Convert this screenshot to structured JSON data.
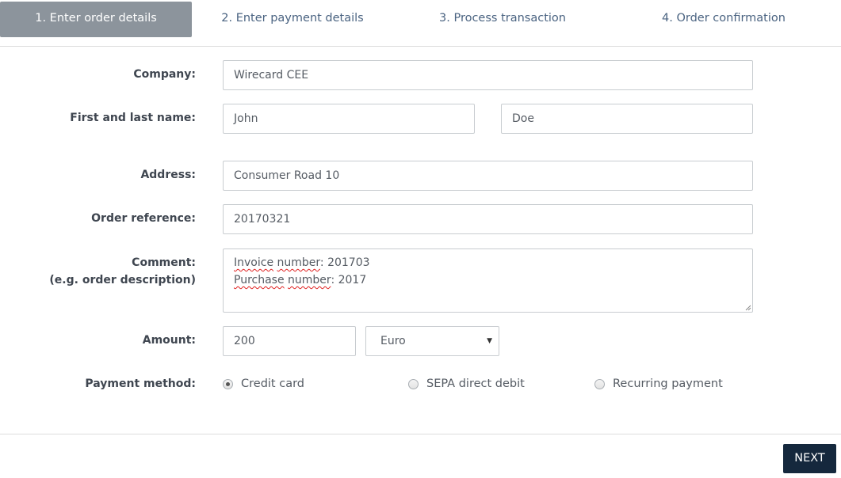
{
  "steps": [
    {
      "label": "1. Enter order details",
      "active": true
    },
    {
      "label": "2. Enter payment details",
      "active": false
    },
    {
      "label": "3. Process transaction",
      "active": false
    },
    {
      "label": "4. Order confirmation",
      "active": false
    }
  ],
  "form": {
    "company": {
      "label": "Company:",
      "value": "Wirecard CEE"
    },
    "name": {
      "label": "First and last name:",
      "first": "John",
      "last": "Doe"
    },
    "address": {
      "label": "Address:",
      "value": "Consumer Road 10"
    },
    "order_reference": {
      "label": "Order reference:",
      "value": "20170321"
    },
    "comment": {
      "label_line1": "Comment:",
      "label_line2": "(e.g. order description)",
      "line1_word1": "Invoice",
      "line1_word2": "number",
      "line1_rest": ": 201703",
      "line2_word1": "Purchase",
      "line2_word2": "number",
      "line2_rest": ": 2017"
    },
    "amount": {
      "label": "Amount:",
      "value": "200",
      "currency": "Euro"
    },
    "payment_method": {
      "label": "Payment method:",
      "options": [
        {
          "label": "Credit card",
          "checked": true
        },
        {
          "label": "SEPA direct debit",
          "checked": false
        },
        {
          "label": "Recurring payment",
          "checked": false
        }
      ]
    }
  },
  "footer": {
    "next_label": "NEXT"
  },
  "colors": {
    "active_step_bg": "#8c949c",
    "step_text": "#4a6381",
    "next_button_bg": "#15283d"
  }
}
